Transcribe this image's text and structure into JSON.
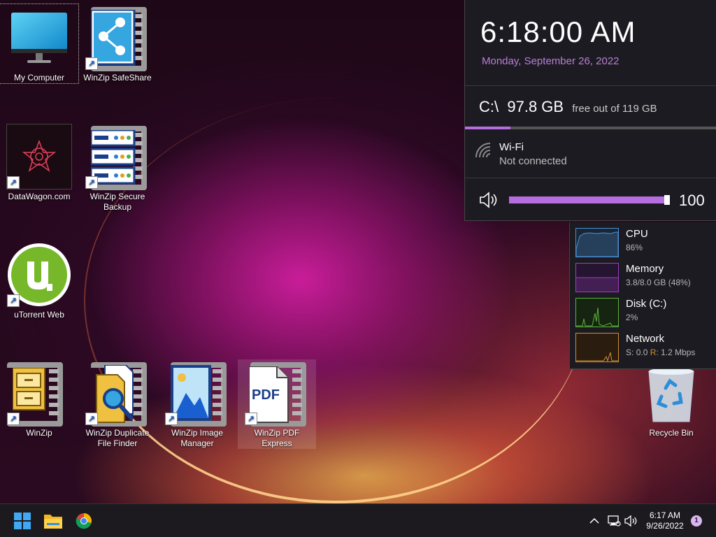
{
  "desktop": {
    "icons": {
      "my_computer": "My Computer",
      "winzip_safeshare": "WinZip SafeShare",
      "datawagon": "DataWagon.com",
      "winzip_secure_backup": "WinZip Secure Backup",
      "utorrent_web": "uTorrent Web",
      "winzip": "WinZip",
      "winzip_duplicate_file_finder": "WinZip Duplicate File Finder",
      "winzip_image_manager": "WinZip Image Manager",
      "winzip_pdf_express": "WinZip PDF Express",
      "recycle_bin": "Recycle Bin"
    },
    "pdf_text": "PDF"
  },
  "widget": {
    "time": "6:18:00 AM",
    "date": "Monday, September 26, 2022",
    "drive": {
      "label": "C:\\",
      "free": "97.8 GB",
      "detail": "free out of 119 GB",
      "used_fraction": 0.18
    },
    "wifi": {
      "title": "Wi-Fi",
      "status": "Not connected"
    },
    "volume": {
      "value": "100",
      "level_fraction": 1.0
    }
  },
  "performance": {
    "cpu": {
      "name": "CPU",
      "value": "86%"
    },
    "memory": {
      "name": "Memory",
      "value": "3.8/8.0 GB (48%)"
    },
    "disk": {
      "name": "Disk (C:)",
      "value": "2%"
    },
    "network": {
      "name": "Network",
      "send_label": "S:",
      "send_value": "0.0",
      "recv_label": "R:",
      "recv_value": "1.2 Mbps"
    }
  },
  "taskbar": {
    "time": "6:17 AM",
    "date": "9/26/2022",
    "notification_count": "1"
  },
  "colors": {
    "accent": "#b66de0",
    "cpu": "#4a8fd6",
    "memory": "#9a3fbf",
    "disk": "#5fb33a",
    "network": "#d28e33"
  }
}
